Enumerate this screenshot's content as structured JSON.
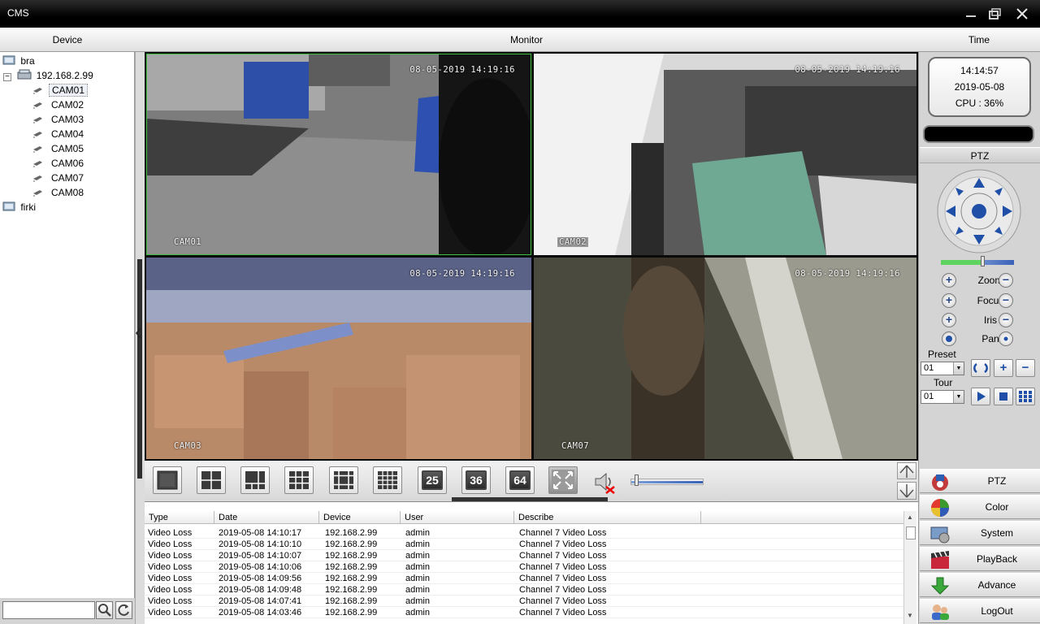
{
  "window": {
    "title": "CMS"
  },
  "headers": {
    "device": "Device",
    "monitor": "Monitor",
    "time": "Time"
  },
  "tree": {
    "root": "bra",
    "host": "192.168.2.99",
    "cameras": [
      "CAM01",
      "CAM02",
      "CAM03",
      "CAM04",
      "CAM05",
      "CAM06",
      "CAM07",
      "CAM08"
    ],
    "other": "firki"
  },
  "search": {
    "value": ""
  },
  "cameras": [
    {
      "timestamp": "08-05-2019 14:19:16",
      "label": "CAM01"
    },
    {
      "timestamp": "08-05-2019 14:19:16",
      "label": "CAM02"
    },
    {
      "timestamp": "08-05-2019 14:19:16",
      "label": "CAM03"
    },
    {
      "timestamp": "08-05-2019 14:19:16",
      "label": "CAM07"
    }
  ],
  "layouts": {
    "n25": "25",
    "n36": "36",
    "n64": "64"
  },
  "volume": 0.05,
  "log": {
    "columns": [
      "Type",
      "Date",
      "Device",
      "User",
      "Describe"
    ],
    "rows": [
      {
        "type": "Video Loss",
        "date": "2019-05-08 14:10:17",
        "device": "192.168.2.99",
        "user": "admin",
        "describe": "Channel 7 Video Loss"
      },
      {
        "type": "Video Loss",
        "date": "2019-05-08 14:10:10",
        "device": "192.168.2.99",
        "user": "admin",
        "describe": "Channel 7 Video Loss"
      },
      {
        "type": "Video Loss",
        "date": "2019-05-08 14:10:07",
        "device": "192.168.2.99",
        "user": "admin",
        "describe": "Channel 7 Video Loss"
      },
      {
        "type": "Video Loss",
        "date": "2019-05-08 14:10:06",
        "device": "192.168.2.99",
        "user": "admin",
        "describe": "Channel 7 Video Loss"
      },
      {
        "type": "Video Loss",
        "date": "2019-05-08 14:09:56",
        "device": "192.168.2.99",
        "user": "admin",
        "describe": "Channel 7 Video Loss"
      },
      {
        "type": "Video Loss",
        "date": "2019-05-08 14:09:48",
        "device": "192.168.2.99",
        "user": "admin",
        "describe": "Channel 7 Video Loss"
      },
      {
        "type": "Video Loss",
        "date": "2019-05-08 14:07:41",
        "device": "192.168.2.99",
        "user": "admin",
        "describe": "Channel 7 Video Loss"
      },
      {
        "type": "Video Loss",
        "date": "2019-05-08 14:03:46",
        "device": "192.168.2.99",
        "user": "admin",
        "describe": "Channel 7 Video Loss"
      }
    ]
  },
  "clock": {
    "time": "14:14:57",
    "date": "2019-05-08",
    "cpu": "CPU : 36%"
  },
  "ptz": {
    "title": "PTZ",
    "zoom": "Zoom",
    "focus": "Focus",
    "iris": "Iris",
    "pan": "Pan",
    "preset_label": "Preset",
    "preset_value": "01",
    "tour_label": "Tour",
    "tour_value": "01"
  },
  "menu": [
    "PTZ",
    "Color",
    "System",
    "PlayBack",
    "Advance",
    "LogOut"
  ],
  "icons": {
    "minimize": "minimize-icon",
    "restore": "restore-icon",
    "close": "close-icon",
    "search": "search-icon",
    "refresh": "refresh-icon",
    "mute": "speaker-muted-icon",
    "fullscreen": "fullscreen-icon"
  }
}
